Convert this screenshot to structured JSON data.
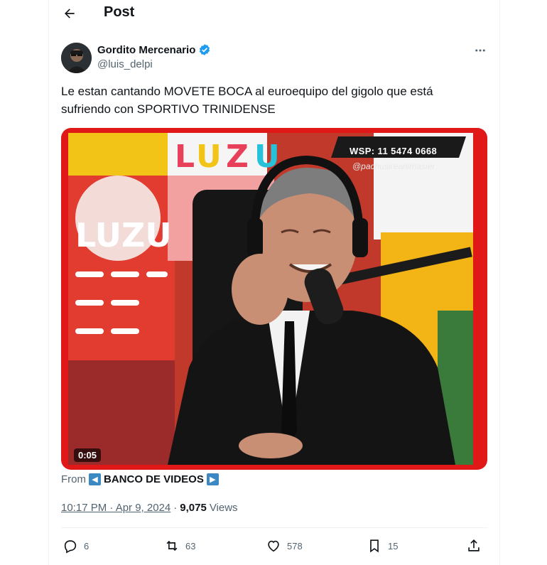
{
  "header": {
    "title": "Post"
  },
  "author": {
    "name": "Gordito Mercenario",
    "handle": "@luis_delpi",
    "verified": true
  },
  "tweet": {
    "text": "Le estan cantando MOVETE BOCA al euroequipo del gigolo que está sufriendo con SPORTIVO TRINIDENSE"
  },
  "media": {
    "duration": "0:05",
    "overlay_phone": "WSP: 11 5474 0668",
    "overlay_handle": "@pachusireanimasier",
    "brand_text": "LUZU",
    "border_color": "#e01818"
  },
  "source": {
    "from_label": "From",
    "name": "BANCO DE VIDEOS"
  },
  "meta": {
    "timestamp": "10:17 PM · Apr 9, 2024",
    "separator": "·",
    "views_count": "9,075",
    "views_label": "Views"
  },
  "actions": {
    "replies": "6",
    "reposts": "63",
    "likes": "578",
    "bookmarks": "15"
  },
  "icons": [
    "back-arrow-icon",
    "verified-badge-icon",
    "more-icon",
    "reply-icon",
    "repost-icon",
    "like-icon",
    "bookmark-icon",
    "share-icon"
  ]
}
